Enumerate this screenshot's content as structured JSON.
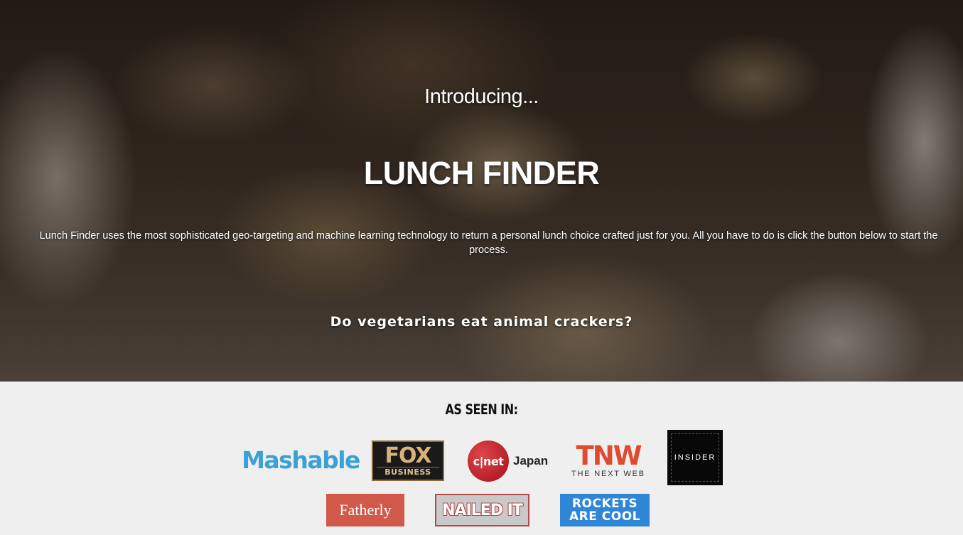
{
  "hero": {
    "intro": "Introducing...",
    "title": "LUNCH FINDER",
    "description": "Lunch Finder uses the most sophisticated geo-targeting and machine learning technology to return a personal lunch choice crafted just for you. All you have to do is click the button below to start the process.",
    "question": "Do vegetarians eat animal crackers?"
  },
  "as_seen_in": {
    "heading": "AS SEEN IN:",
    "logos": {
      "mashable": "Mashable",
      "fox_top": "FOX",
      "fox_bottom": "BUSINESS",
      "cnet": "c|net",
      "cnet_japan": "Japan",
      "tnw_big": "TNW",
      "tnw_small": "THE NEXT WEB",
      "insider": "INSIDER",
      "fatherly": "Fatherly",
      "nailed": "NAILED IT",
      "rockets_line1": "ROCKETS",
      "rockets_line2": "ARE COOL"
    }
  },
  "colors": {
    "mashable": "#3aa0d6",
    "tnw": "#e04a2d",
    "fatherly": "#d1594a",
    "rockets": "#2f86d6",
    "cnet": "#c1202a"
  }
}
